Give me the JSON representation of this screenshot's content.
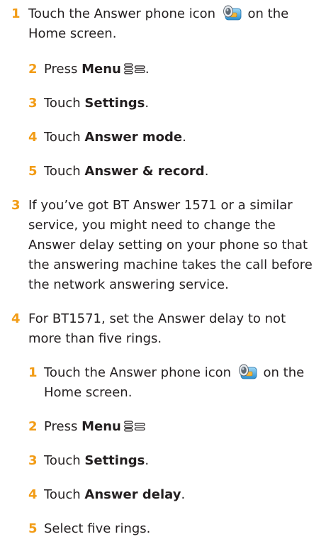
{
  "steps": {
    "s1": {
      "num": "1",
      "a": "Touch the Answer phone icon",
      "b": "on the Home screen."
    },
    "s2": {
      "num": "2",
      "a": "Press",
      "b": "Menu",
      "c": "."
    },
    "s3": {
      "num": "3",
      "a": "Touch",
      "b": "Settings",
      "c": "."
    },
    "s4": {
      "num": "4",
      "a": "Touch",
      "b": "Answer mode",
      "c": "."
    },
    "s5": {
      "num": "5",
      "a": "Touch",
      "b": "Answer & record",
      "c": "."
    },
    "p3": {
      "num": "3",
      "text": "If you’ve got BT Answer 1571 or a similar service, you might need to change the Answer delay setting on your phone so that the answering machine takes the call before the network answering service."
    },
    "p4": {
      "num": "4",
      "text": "For BT1571, set the Answer delay to not more than five rings."
    },
    "t1": {
      "num": "1",
      "a": "Touch the Answer phone icon",
      "b": "on the Home screen."
    },
    "t2": {
      "num": "2",
      "a": "Press",
      "b": "Menu"
    },
    "t3": {
      "num": "3",
      "a": "Touch",
      "b": "Settings",
      "c": "."
    },
    "t4": {
      "num": "4",
      "a": "Touch",
      "b": "Answer delay",
      "c": "."
    },
    "t5": {
      "num": "5",
      "a": "Select five rings."
    }
  },
  "icons": {
    "answer_phone": "answer-phone-icon",
    "menu_key": "menu-key-icon"
  },
  "colors": {
    "step_number": "#f29c16",
    "text": "#231f20"
  }
}
